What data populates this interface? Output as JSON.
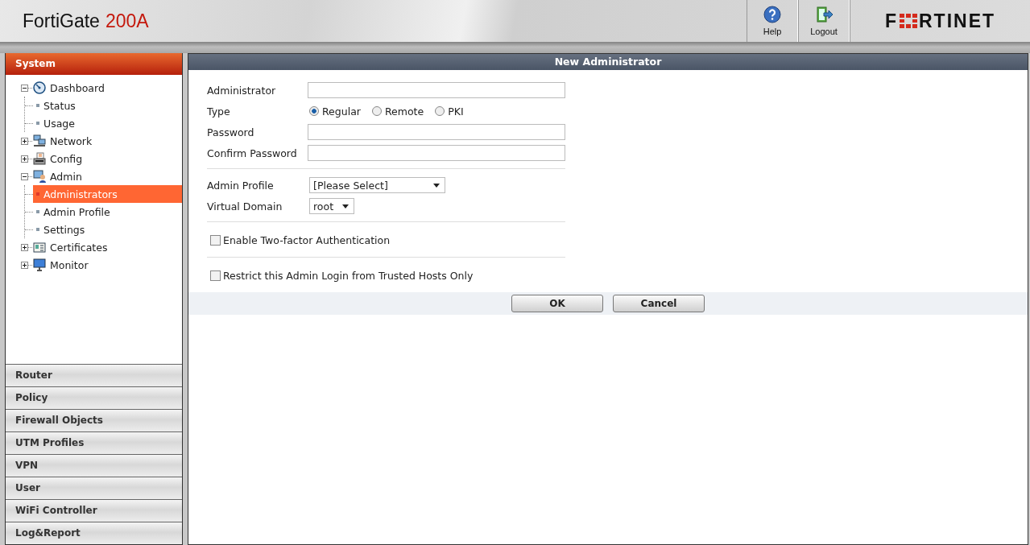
{
  "header": {
    "product": "FortiGate",
    "model": "200A",
    "buttons": [
      {
        "kind": "help",
        "label": "Help"
      },
      {
        "kind": "logout",
        "label": "Logout"
      }
    ],
    "logo": [
      "F",
      "RTINET"
    ]
  },
  "sidebar": {
    "active_section": {
      "title": "System",
      "tree": [
        {
          "label": "Dashboard",
          "kind": "gauge",
          "expanded": true,
          "children": [
            {
              "label": "Status",
              "selected": false
            },
            {
              "label": "Usage",
              "selected": false
            }
          ]
        },
        {
          "label": "Network",
          "kind": "network",
          "expanded": false
        },
        {
          "label": "Config",
          "kind": "config",
          "expanded": false
        },
        {
          "label": "Admin",
          "kind": "admin",
          "expanded": true,
          "children": [
            {
              "label": "Administrators",
              "selected": true
            },
            {
              "label": "Admin Profile",
              "selected": false
            },
            {
              "label": "Settings",
              "selected": false
            }
          ]
        },
        {
          "label": "Certificates",
          "kind": "certificate",
          "expanded": false
        },
        {
          "label": "Monitor",
          "kind": "monitor",
          "expanded": false
        }
      ]
    },
    "sections": [
      "Router",
      "Policy",
      "Firewall Objects",
      "UTM Profiles",
      "VPN",
      "User",
      "WiFi Controller",
      "Log&Report"
    ]
  },
  "form": {
    "title": "New Administrator",
    "rows": [
      {
        "kind": "text",
        "label": "Administrator"
      },
      {
        "kind": "radio",
        "label": "Type",
        "options": [
          {
            "label": "Regular",
            "selected": true
          },
          {
            "label": "Remote",
            "selected": false
          },
          {
            "label": "PKI",
            "selected": false
          }
        ]
      },
      {
        "kind": "text",
        "label": "Password"
      },
      {
        "kind": "text",
        "label": "Confirm Password"
      },
      {
        "kind": "divider"
      },
      {
        "kind": "select",
        "label": "Admin Profile",
        "value": "[Please Select]"
      },
      {
        "kind": "select",
        "label": "Virtual Domain",
        "value": "root"
      },
      {
        "kind": "divider"
      },
      {
        "kind": "checkbox",
        "label": "Enable Two-factor Authentication",
        "checked": false
      },
      {
        "kind": "divider"
      },
      {
        "kind": "checkbox",
        "label": "Restrict this Admin Login from Trusted Hosts Only",
        "checked": false
      }
    ],
    "buttons": [
      "OK",
      "Cancel"
    ]
  }
}
